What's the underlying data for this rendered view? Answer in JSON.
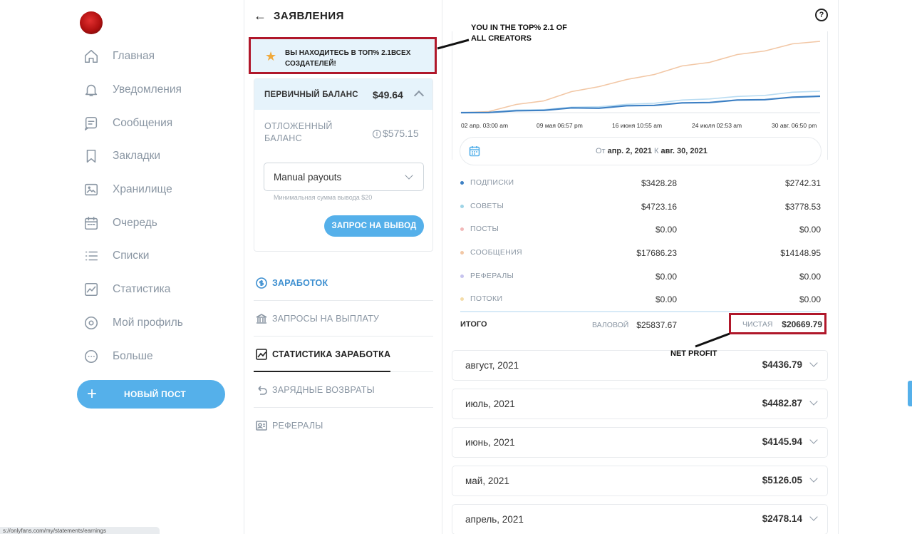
{
  "sidebar": {
    "items": [
      {
        "label": "Главная",
        "icon": "home-icon"
      },
      {
        "label": "Уведомления",
        "icon": "bell-icon"
      },
      {
        "label": "Сообщения",
        "icon": "message-icon"
      },
      {
        "label": "Закладки",
        "icon": "bookmark-icon"
      },
      {
        "label": "Хранилище",
        "icon": "vault-icon"
      },
      {
        "label": "Очередь",
        "icon": "calendar-icon"
      },
      {
        "label": "Списки",
        "icon": "list-icon"
      },
      {
        "label": "Статистика",
        "icon": "stats-icon"
      },
      {
        "label": "Мой профиль",
        "icon": "profile-icon"
      },
      {
        "label": "Больше",
        "icon": "more-icon"
      }
    ],
    "new_post": "НОВЫЙ ПОСТ"
  },
  "header": {
    "title": "ЗАЯВЛЕНИЯ",
    "back": "←",
    "help": "?"
  },
  "top_notice": "ВЫ НАХОДИТЕСЬ В ТОП% 2.1ВСЕХ СОЗДАТЕЛЕЙ!",
  "balance": {
    "primary_label": "ПЕРВИЧНЫЙ БАЛАНС",
    "primary_value": "$49.64",
    "pending_label": "ОТЛОЖЕННЫЙ БАЛАНС",
    "pending_value": "$575.15",
    "payout_select": "Manual payouts",
    "min_withdraw": "Минимальная сумма вывода $20",
    "withdraw_button": "ЗАПРОС НА ВЫВОД"
  },
  "tabs": [
    {
      "label": "ЗАРАБОТОК",
      "icon": "dollar-icon"
    },
    {
      "label": "ЗАПРОСЫ НА ВЫПЛАТУ",
      "icon": "bank-icon"
    },
    {
      "label": "СТАТИСТИКА ЗАРАБОТКА",
      "icon": "chart-icon"
    },
    {
      "label": "ЗАРЯДНЫЕ ВОЗВРАТЫ",
      "icon": "undo-icon"
    },
    {
      "label": "РЕФЕРАЛЫ",
      "icon": "referral-icon"
    }
  ],
  "chart": {
    "x_labels": [
      "02 апр. 03:00 am",
      "09 мая 06:57 pm",
      "16 июня 10:55 am",
      "24 июля 02:53 am",
      "30 авг. 06:50 pm"
    ],
    "series": [
      {
        "name": "",
        "color": "#f2c7a5",
        "values": [
          0.0,
          0.03,
          0.1,
          0.18,
          0.28,
          0.38,
          0.45,
          0.55,
          0.64,
          0.72,
          0.8,
          0.88,
          0.95,
          1.0
        ]
      },
      {
        "name": "",
        "color": "#b9dcf2",
        "values": [
          0.0,
          0.01,
          0.03,
          0.05,
          0.07,
          0.09,
          0.11,
          0.14,
          0.17,
          0.2,
          0.22,
          0.25,
          0.28,
          0.3
        ]
      },
      {
        "name": "",
        "color": "#3d80c4",
        "values": [
          0.0,
          0.01,
          0.02,
          0.04,
          0.06,
          0.07,
          0.09,
          0.11,
          0.13,
          0.15,
          0.17,
          0.19,
          0.21,
          0.23
        ]
      }
    ]
  },
  "date_range": {
    "from_label": "От",
    "from": "апр. 2, 2021",
    "to_label": "К",
    "to": "авг. 30, 2021"
  },
  "breakdown": [
    {
      "name": "ПОДПИСКИ",
      "gross": "$3428.28",
      "net": "$2742.31",
      "color": "#3d80c4"
    },
    {
      "name": "СОВЕТЫ",
      "gross": "$4723.16",
      "net": "$3778.53",
      "color": "#9fd4e6"
    },
    {
      "name": "ПОСТЫ",
      "gross": "$0.00",
      "net": "$0.00",
      "color": "#f2b8b8"
    },
    {
      "name": "СООБЩЕНИЯ",
      "gross": "$17686.23",
      "net": "$14148.95",
      "color": "#f2c7a5"
    },
    {
      "name": "РЕФЕРАЛЫ",
      "gross": "$0.00",
      "net": "$0.00",
      "color": "#c6c3ee"
    },
    {
      "name": "ПОТОКИ",
      "gross": "$0.00",
      "net": "$0.00",
      "color": "#f4dca8"
    }
  ],
  "total": {
    "name": "ИТОГО",
    "gross_label": "ВАЛОВОЙ",
    "gross": "$25837.67",
    "net_label": "ЧИСТАЯ",
    "net": "$20669.79"
  },
  "months": [
    {
      "month": "август, 2021",
      "value": "$4436.79"
    },
    {
      "month": "июль, 2021",
      "value": "$4482.87"
    },
    {
      "month": "июнь, 2021",
      "value": "$4145.94"
    },
    {
      "month": "май, 2021",
      "value": "$5126.05"
    },
    {
      "month": "апрель, 2021",
      "value": "$2478.14"
    }
  ],
  "annotations": {
    "top": "YOU IN THE TOP% 2.1 OF ALL CREATORS",
    "net": "NET PROFIT"
  },
  "status_url": "s://onlyfans.com/my/statements/earnings"
}
